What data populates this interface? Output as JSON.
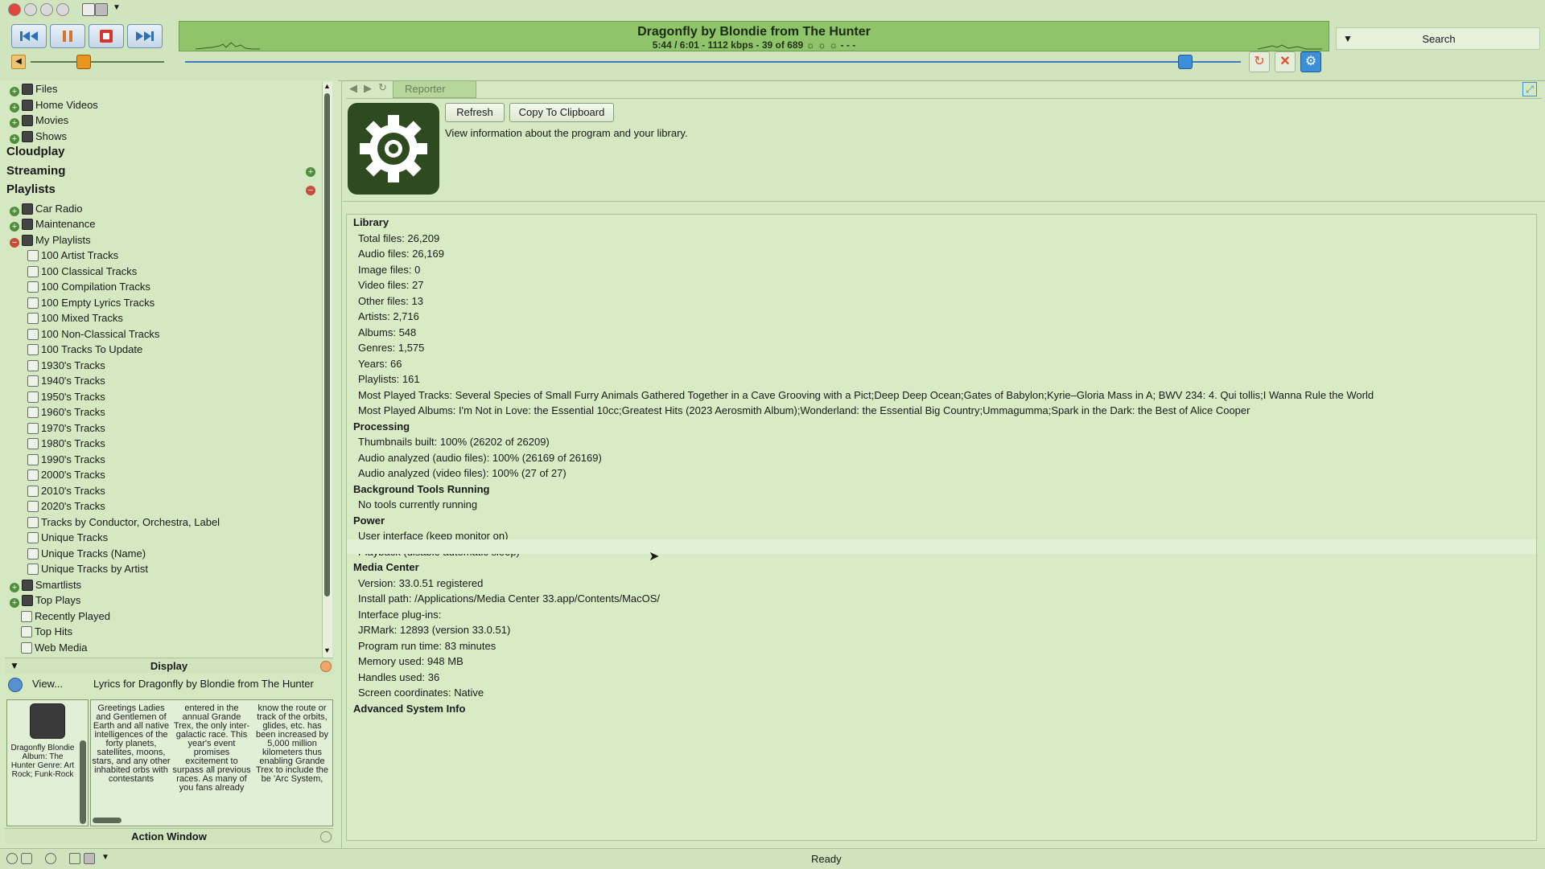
{
  "player": {
    "now_playing_title": "Dragonfly by Blondie from The Hunter",
    "now_playing_sub": "5:44 / 6:01 - 1112 kbps -  39 of 689",
    "search_label": "Search"
  },
  "sidebar": {
    "top_items": [
      "Files",
      "Home Videos",
      "Movies",
      "Shows"
    ],
    "cloudplay": "Cloudplay",
    "streaming": "Streaming",
    "playlists": "Playlists",
    "playlist_groups": [
      "Car Radio",
      "Maintenance",
      "My Playlists"
    ],
    "my_playlists": [
      "100 Artist Tracks",
      "100 Classical Tracks",
      "100 Compilation Tracks",
      "100 Empty Lyrics Tracks",
      "100 Mixed Tracks",
      "100 Non-Classical Tracks",
      "100 Tracks To Update",
      "1930's Tracks",
      "1940's Tracks",
      "1950's Tracks",
      "1960's Tracks",
      "1970's Tracks",
      "1980's Tracks",
      "1990's Tracks",
      "2000's Tracks",
      "2010's Tracks",
      "2020's Tracks",
      "Tracks by Conductor, Orchestra, Label",
      "Unique Tracks",
      "Unique Tracks (Name)",
      "Unique Tracks by Artist"
    ],
    "bottom_groups": [
      "Smartlists",
      "Top Plays"
    ],
    "top_plays_items": [
      "Recently Played",
      "Top Hits",
      "Web Media"
    ]
  },
  "display": {
    "header": "Display",
    "view_label": "View...",
    "lyrics_title": "Lyrics for Dragonfly by Blondie from The Hunter",
    "track_info": "Dragonfly Blondie Album: The Hunter Genre: Art Rock; Funk-Rock",
    "lyrics_cols": [
      "Greetings Ladies and Gentlemen of Earth and all native intelligences of the forty planets, satellites, moons, stars, and any other inhabited orbs with contestants",
      "entered in the annual Grande Trex, the only inter-galactic race. This year's event promises excitement to surpass all previous races. As many of you fans already",
      "know the route or track of the orbits, glides, etc. has been increased by 5,000 million kilometers thus enabling Grande Trex to include the be 'Arc System,"
    ],
    "action_window": "Action Window"
  },
  "reporter": {
    "tab": "Reporter",
    "refresh": "Refresh",
    "copy": "Copy To Clipboard",
    "description": "View information about the program and your library.",
    "lines": [
      {
        "t": "Library",
        "h": true
      },
      {
        "t": "Total files: 26,209"
      },
      {
        "t": "Audio files: 26,169"
      },
      {
        "t": "Image files: 0"
      },
      {
        "t": "Video files: 27"
      },
      {
        "t": "Other files: 13"
      },
      {
        "t": "Artists: 2,716"
      },
      {
        "t": "Albums: 548"
      },
      {
        "t": "Genres: 1,575"
      },
      {
        "t": "Years: 66"
      },
      {
        "t": "Playlists: 161"
      },
      {
        "t": "Most Played Tracks: Several Species of Small Furry Animals Gathered Together in a Cave Grooving with a Pict;Deep Deep Ocean;Gates of Babylon;Kyrie–Gloria Mass in A; BWV 234: 4. Qui tollis;I Wanna Rule the World"
      },
      {
        "t": "Most Played Albums: I'm Not in Love: the Essential 10cc;Greatest Hits (2023 Aerosmith Album);Wonderland: the Essential Big Country;Ummagumma;Spark in the Dark: the Best of Alice Cooper"
      },
      {
        "t": "Processing",
        "h": true
      },
      {
        "t": "Thumbnails built: 100% (26202 of 26209)"
      },
      {
        "t": "Audio analyzed (audio files): 100% (26169 of 26169)"
      },
      {
        "t": "Audio analyzed (video files): 100% (27 of 27)"
      },
      {
        "t": "Background Tools Running",
        "h": true
      },
      {
        "t": "No tools currently running"
      },
      {
        "t": "Power",
        "h": true
      },
      {
        "t": "User interface (keep monitor on)"
      },
      {
        "t": "Playback (disable automatic sleep)"
      },
      {
        "t": "Media Center",
        "h": true
      },
      {
        "t": "Version: 33.0.51 registered"
      },
      {
        "t": "Install path: /Applications/Media Center 33.app/Contents/MacOS/"
      },
      {
        "t": "Interface plug-ins:"
      },
      {
        "t": "JRMark: 12893 (version 33.0.51)"
      },
      {
        "t": "Program run time: 83 minutes"
      },
      {
        "t": "Memory used: 948 MB"
      },
      {
        "t": "Handles used: 36"
      },
      {
        "t": "Screen coordinates: Native"
      },
      {
        "t": "Advanced System Info",
        "h": true
      }
    ]
  },
  "status": {
    "text": "Ready"
  },
  "colors": {
    "accent_green": "#8fc46b",
    "icon_dark": "#2e4a1f",
    "stop_red": "#d8342a",
    "shuffle_red": "#e24c2c",
    "settings_blue": "#3a8fd8"
  }
}
